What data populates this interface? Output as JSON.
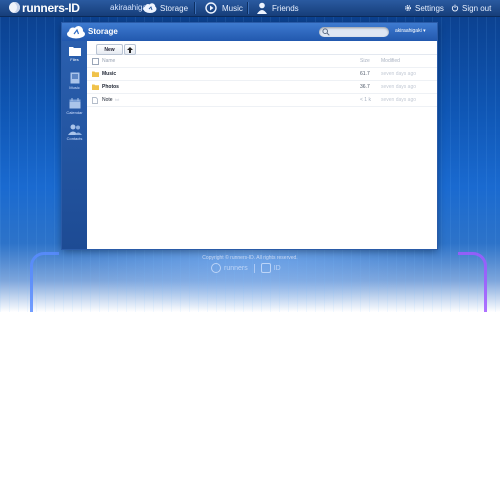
{
  "brand": {
    "name": "runners-ID",
    "username": "akiraahigaki"
  },
  "nav": {
    "items": [
      {
        "label": "Storage",
        "icon": "cloud-icon"
      },
      {
        "label": "Music",
        "icon": "music-icon"
      },
      {
        "label": "Friends",
        "icon": "user-icon"
      }
    ],
    "settings": "Settings",
    "signout": "Sign out"
  },
  "panel": {
    "title": "Storage",
    "search_placeholder": "",
    "user_menu": "akiraahigaki ▾"
  },
  "sidebar": [
    {
      "label": "Files",
      "icon": "folder-icon"
    },
    {
      "label": "Music",
      "icon": "music-icon"
    },
    {
      "label": "Calendar",
      "icon": "calendar-icon"
    },
    {
      "label": "Contacts",
      "icon": "contacts-icon"
    }
  ],
  "toolbar": {
    "new_label": "New",
    "up_icon": "arrow-up-icon"
  },
  "table": {
    "headers": {
      "name": "Name",
      "size": "Size",
      "modified": "Modified"
    },
    "rows": [
      {
        "name": "Music",
        "badge": "",
        "size": "61.7",
        "modified": "seven days ago",
        "type": "folder"
      },
      {
        "name": "Photos",
        "badge": "",
        "size": "36.7",
        "modified": "seven days ago",
        "type": "folder"
      },
      {
        "name": "Note",
        "badge": "txt",
        "size": "< 1 k",
        "modified": "seven days ago",
        "type": "file"
      }
    ]
  },
  "footer": {
    "copyright": "Copyright © runners-ID. All rights reserved.",
    "logo1": "runners",
    "logo2": "ID"
  },
  "colors": {
    "topbar": "#1f4b8e",
    "panel_header": "#2f6cc4",
    "sidebar": "#245599",
    "folder": "#f0c24a",
    "scene": "#1560c8"
  }
}
